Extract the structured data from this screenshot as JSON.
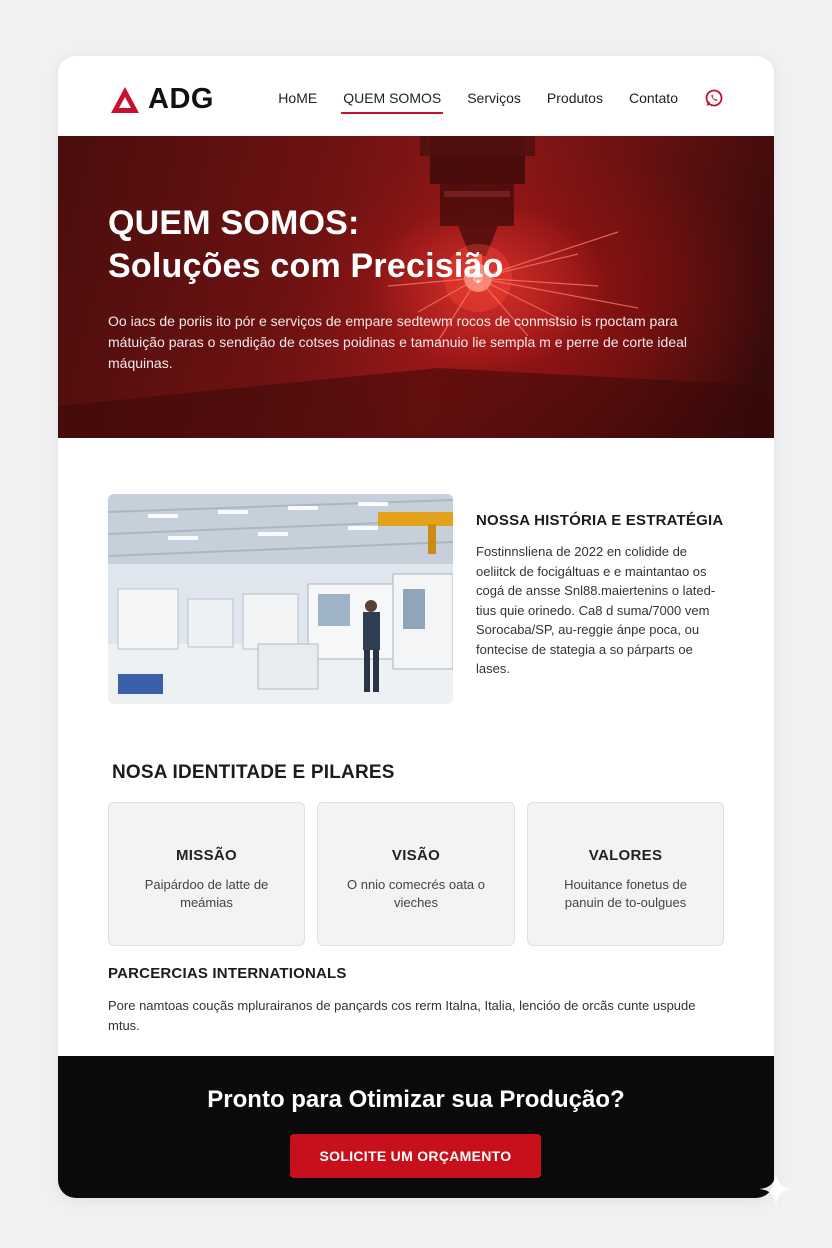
{
  "brand": {
    "name": "ADG",
    "accent_color": "#c8102e"
  },
  "nav": {
    "items": [
      {
        "label": "HoME",
        "active": false
      },
      {
        "label": "QUEM SOMOS",
        "active": true
      },
      {
        "label": "Serviços",
        "active": false
      },
      {
        "label": "Produtos",
        "active": false
      },
      {
        "label": "Contato",
        "active": false
      }
    ],
    "whatsapp_icon": "whatsapp-icon"
  },
  "hero": {
    "title_line1": "QUEM SOMOS:",
    "title_line2": "Soluções com Precisião",
    "description": "Oo iacs de poriis ito pór e serviços de empare sedtewm rocos de conmstsio is rpoctam para mátuição paras o sendição de cotses poidinas e tamanuio lie sempla m e perre de corte ideal máquinas."
  },
  "history": {
    "title": "NOSSA HISTÓRIA E ESTRATÉGIA",
    "text": "Fostinnsliena de 2022 en colidide de oeliitck de focigáltuas e e maintantao os cogá de ansse Snl88.maiertenins o lated-tius quie orinedo. Ca8 d suma/7000 vem Sorocaba/SP, au-reggie ánpe poca, ou fontecise de stategia a so párparts oe lases."
  },
  "identity": {
    "title": "NOSA IDENTITADE E PILARES",
    "pillars": [
      {
        "title": "MISSÃO",
        "text": "Paipárdoo de latte de meámias"
      },
      {
        "title": "VISÃO",
        "text": "O nnio comecrés oata o vieches"
      },
      {
        "title": "VALORES",
        "text": "Houitance fonetus de panuin de to-oulgues"
      }
    ]
  },
  "partners": {
    "title": "PARCERCIAS INTERNATIONALS",
    "text": "Pore namtoas couçãs mplurairanos de pançards cos rerm Italna, Italia, lencióo de orcãs cunte uspude mtus."
  },
  "cta": {
    "title": "Pronto para Otimizar sua Produção?",
    "button_label": "SOLICITE UM ORÇAMENTO"
  }
}
